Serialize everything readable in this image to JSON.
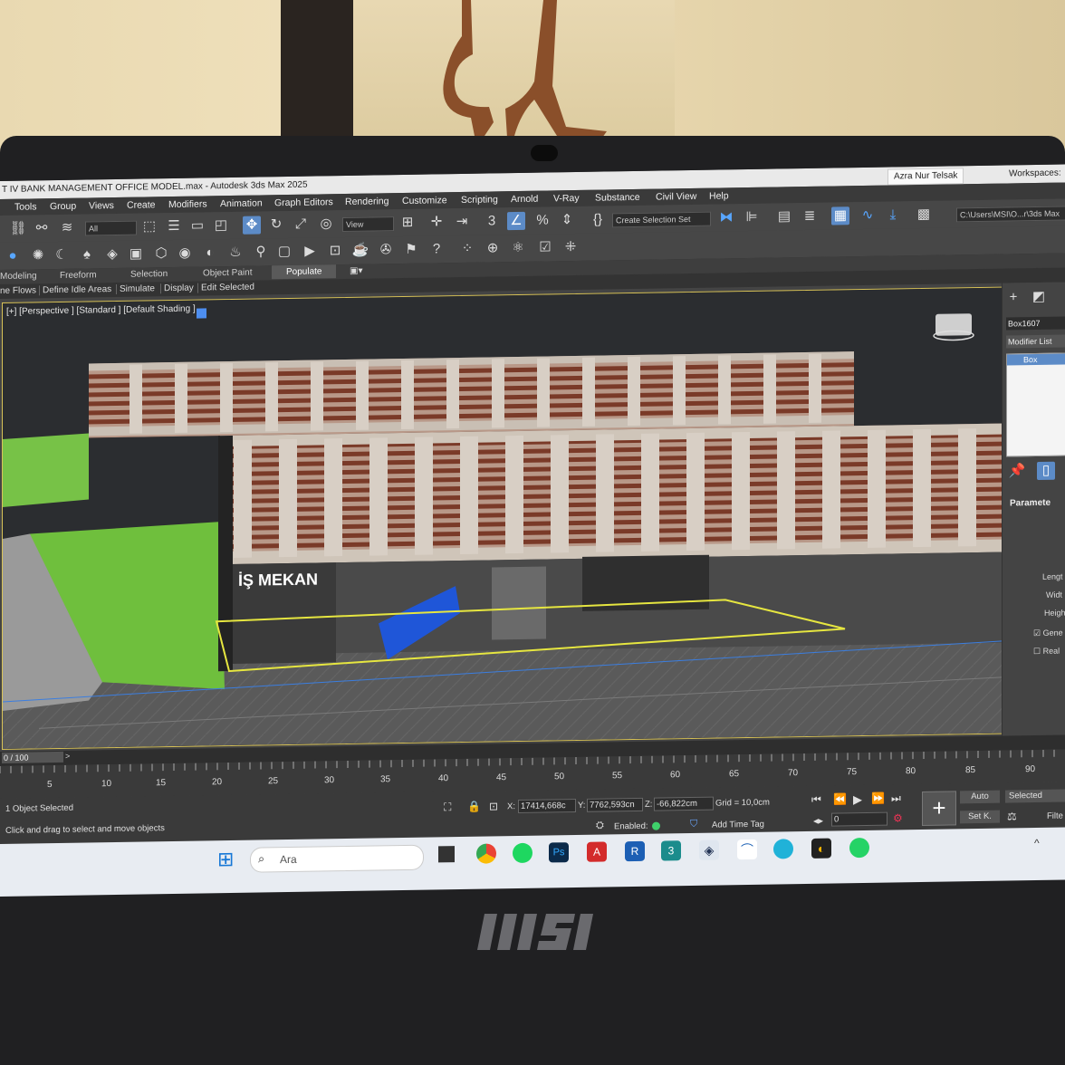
{
  "window": {
    "title": "T IV BANK MANAGEMENT OFFICE MODEL.max - Autodesk 3ds Max 2025",
    "user": "Azra Nur Telsak",
    "workspaces_label": "Workspaces:"
  },
  "menu": [
    "Tools",
    "Group",
    "Views",
    "Create",
    "Modifiers",
    "Animation",
    "Graph Editors",
    "Rendering",
    "Customize",
    "Scripting",
    "Arnold",
    "V-Ray",
    "Substance",
    "Civil View",
    "Help"
  ],
  "toolbar": {
    "filter_all": "All",
    "ref_coord": "View",
    "selection_set": "Create Selection Set",
    "path": "C:\\Users\\MSI\\O...r\\3ds Max"
  },
  "ribbon_tabs": [
    "Modeling",
    "Freeform",
    "Selection",
    "Object Paint",
    "Populate"
  ],
  "populate_tools": [
    "ne Flows",
    "Define Idle Areas",
    "Simulate",
    "Display",
    "Edit Selected"
  ],
  "viewport": {
    "label": "[+] [Perspective ] [Standard ] [Default Shading ]",
    "sign_text": "İŞ MEKAN"
  },
  "command_panel": {
    "object_name": "Box1607",
    "modifier_list": "Modifier List",
    "stack_item": "Box",
    "rollout": "Paramete",
    "params": [
      "Lengt",
      "Widt",
      "Heigh"
    ],
    "checkbox_1": "Gene",
    "checkbox_2": "Real"
  },
  "timeline": {
    "frame": "0 / 100",
    "ticks": [
      "5",
      "10",
      "15",
      "20",
      "25",
      "30",
      "35",
      "40",
      "45",
      "50",
      "55",
      "60",
      "65",
      "70",
      "75",
      "80",
      "85",
      "90"
    ]
  },
  "status": {
    "selected_count": "1 Object Selected",
    "prompt": "Click and drag to select and move objects",
    "x_label": "X:",
    "x_value": "17414,668c",
    "y_label": "Y:",
    "y_value": "7762,593cn",
    "z_label": "Z:",
    "z_value": "-66,822cm",
    "grid": "Grid = 10,0cm",
    "enabled": "Enabled:",
    "add_time_tag": "Add Time Tag",
    "frame_field": "0",
    "auto_key": "Auto",
    "set_key": "Set K.",
    "selected": "Selected",
    "filters": "Filte"
  },
  "taskbar": {
    "search_placeholder": "Ara"
  },
  "laptop_brand": "MSI"
}
